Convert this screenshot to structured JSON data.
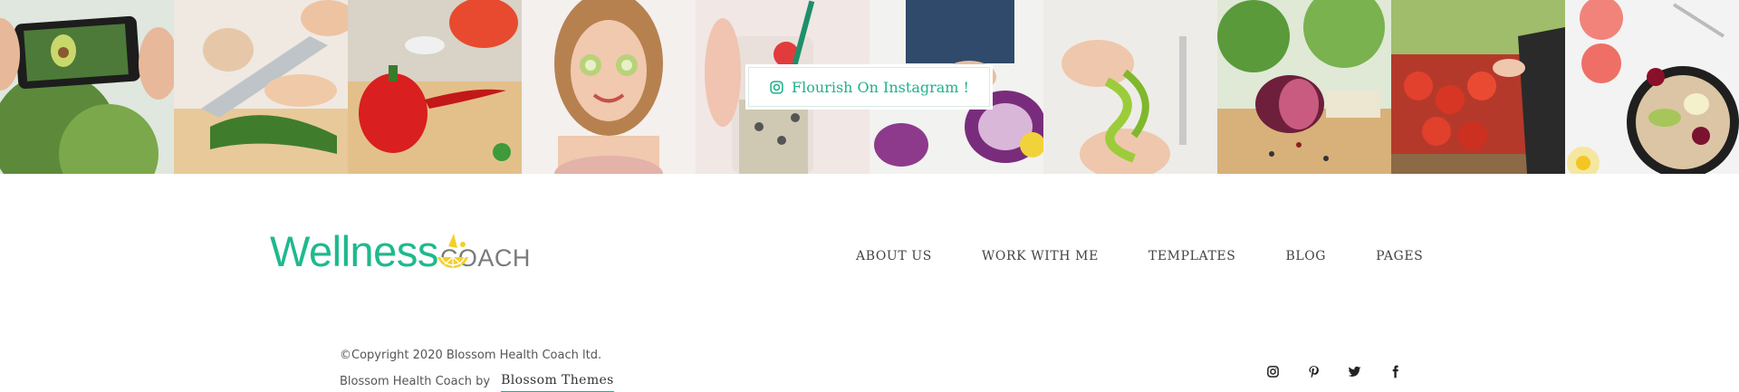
{
  "instagram": {
    "button_label": "Flourish On Instagram !",
    "tiles": [
      {
        "name": "phone-photo-avocado"
      },
      {
        "name": "chopping-greens"
      },
      {
        "name": "red-pepper"
      },
      {
        "name": "woman-cucumber-eyes"
      },
      {
        "name": "smoothie-jar"
      },
      {
        "name": "red-cabbage"
      },
      {
        "name": "green-spiral-veggies"
      },
      {
        "name": "red-onion-board"
      },
      {
        "name": "market-tomatoes"
      },
      {
        "name": "fruit-salad-bowl"
      }
    ]
  },
  "logo": {
    "wellness": "Wellness",
    "coach": "COACH"
  },
  "nav": [
    {
      "label": "ABOUT US"
    },
    {
      "label": "WORK WITH ME"
    },
    {
      "label": "TEMPLATES"
    },
    {
      "label": "BLOG"
    },
    {
      "label": "PAGES"
    }
  ],
  "footer": {
    "copyright": "©Copyright 2020 Blossom Health Coach ltd.",
    "credit_prefix": "Blossom Health Coach by",
    "credit_link": "Blossom Themes"
  },
  "social": [
    {
      "icon": "instagram-icon"
    },
    {
      "icon": "pinterest-icon"
    },
    {
      "icon": "twitter-icon"
    },
    {
      "icon": "facebook-icon"
    }
  ],
  "colors": {
    "accent": "#1fb98e",
    "text": "#444444"
  }
}
